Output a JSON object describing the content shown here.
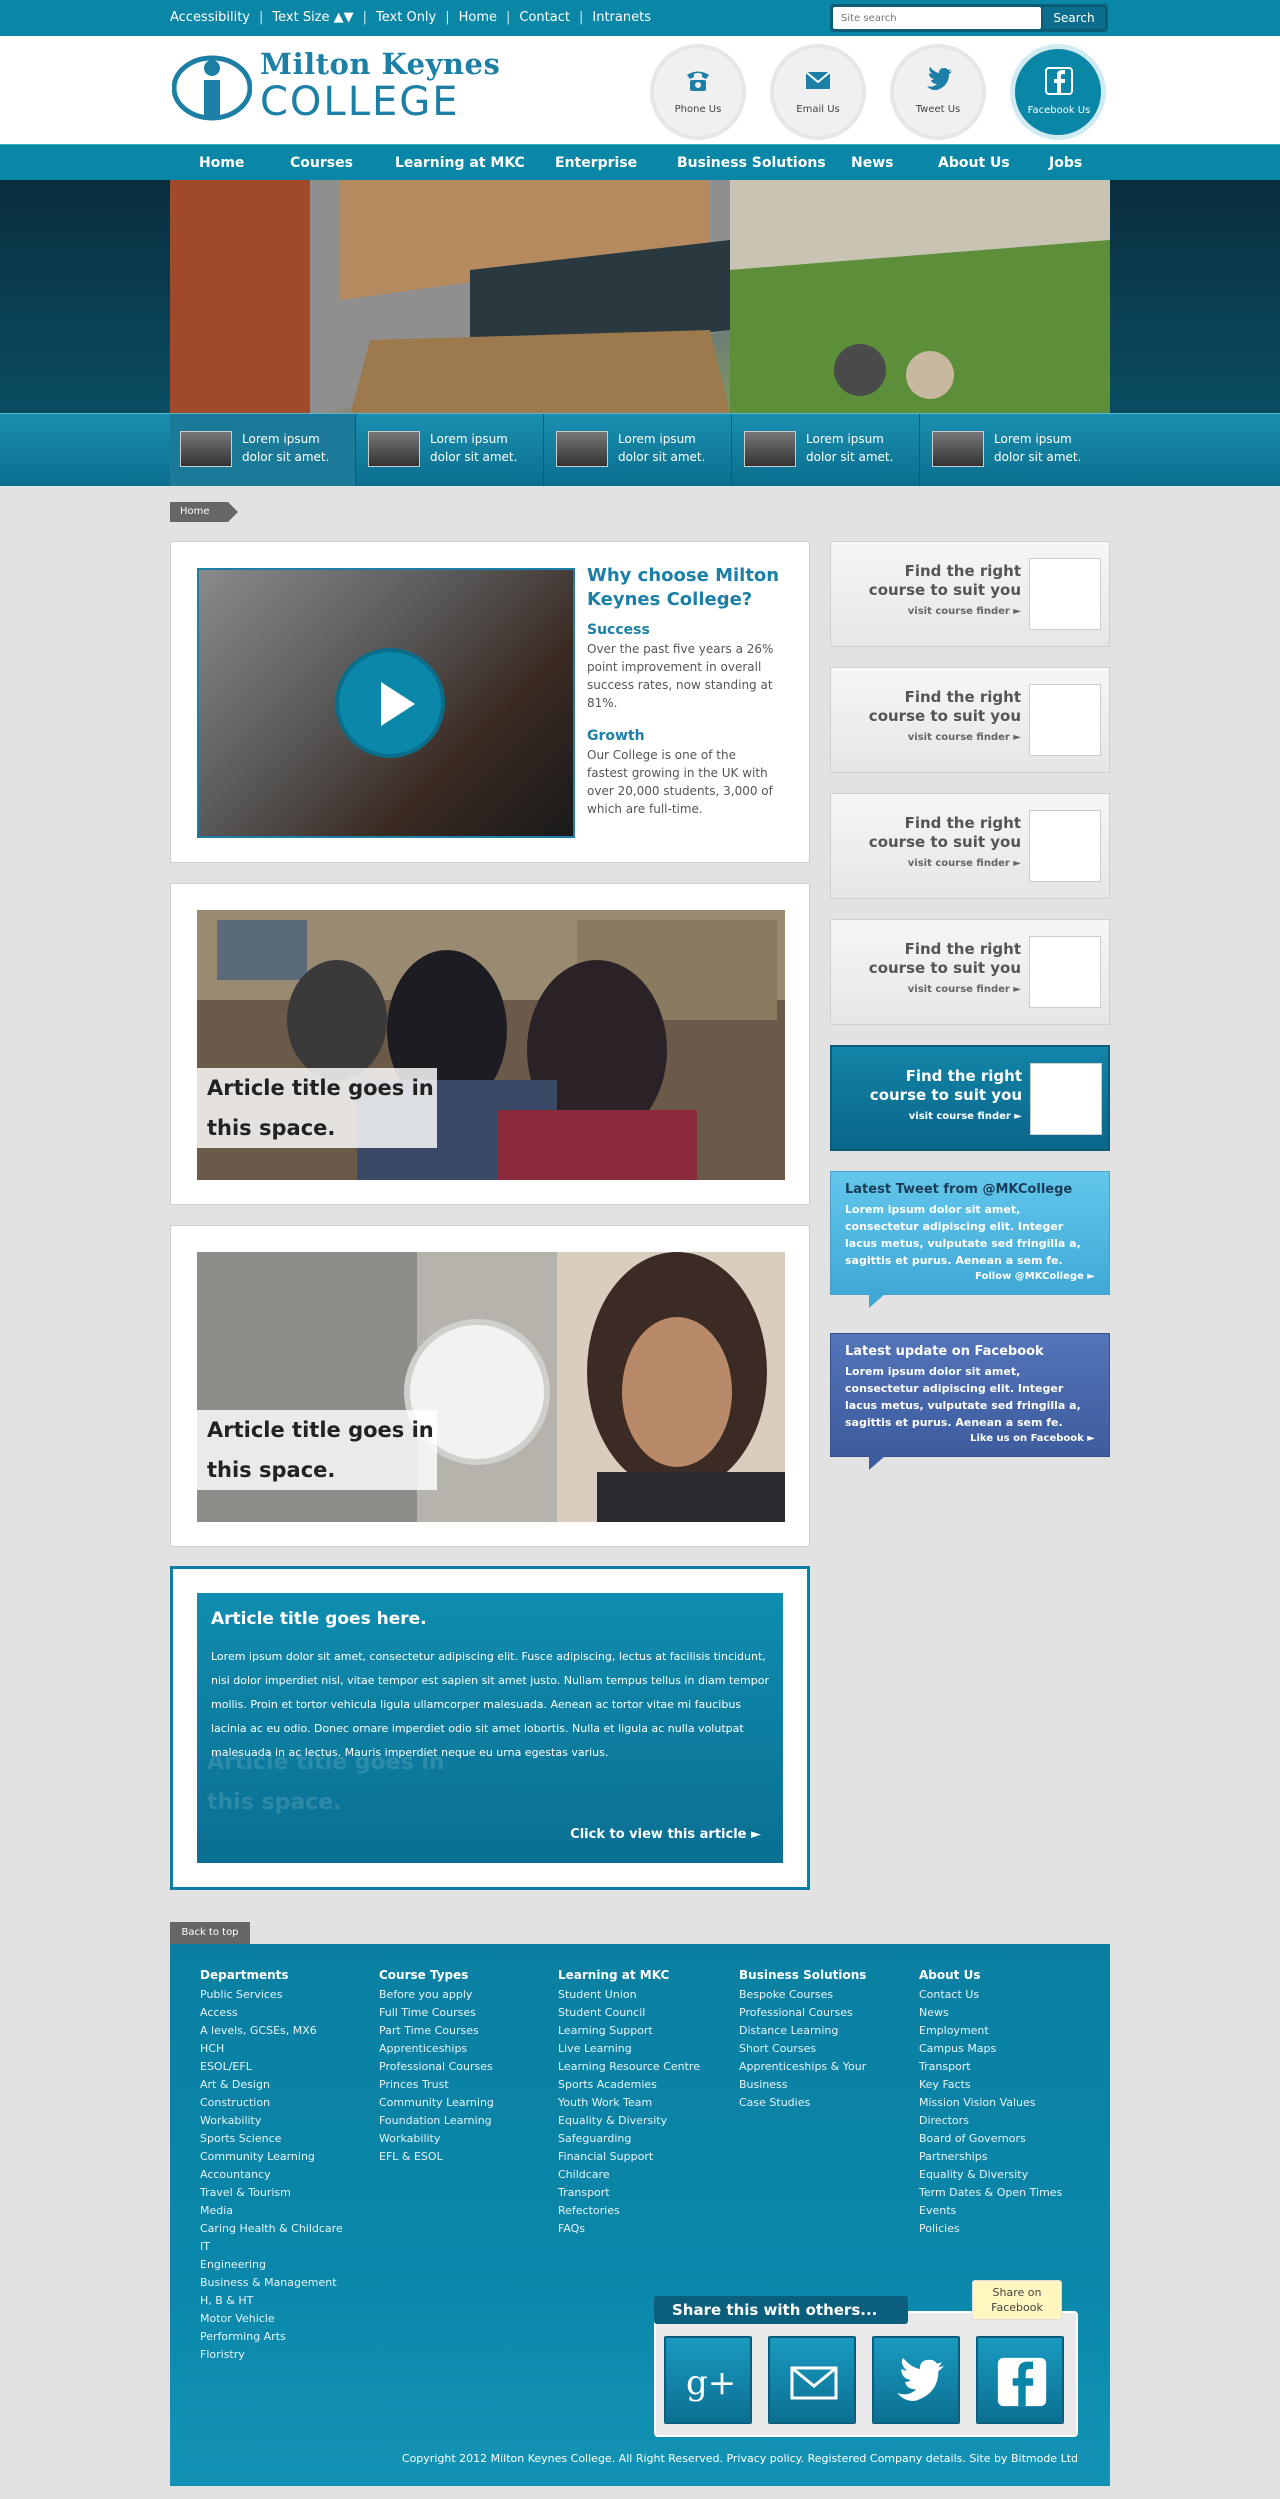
{
  "util": {
    "accessibility": "Accessibility",
    "text_size": "Text Size ▲▼",
    "text_only": "Text Only",
    "home": "Home",
    "contact": "Contact",
    "intranets": "Intranets",
    "search_placeholder": "Site search",
    "search_button": "Search"
  },
  "logo": {
    "line1": "Milton Keynes",
    "line2": "COLLEGE"
  },
  "contact_circles": {
    "phone": "Phone Us",
    "email": "Email Us",
    "tweet": "Tweet Us",
    "facebook": "Facebook Us"
  },
  "nav": {
    "home": "Home",
    "courses": "Courses",
    "learning": "Learning at MKC",
    "enterprise": "Enterprise",
    "business": "Business Solutions",
    "news": "News",
    "about": "About Us",
    "jobs": "Jobs"
  },
  "slides": [
    "Lorem ipsum dolor sit amet.",
    "Lorem ipsum dolor sit amet.",
    "Lorem ipsum dolor sit amet.",
    "Lorem ipsum dolor sit amet.",
    "Lorem ipsum dolor sit amet."
  ],
  "breadcrumb": "Home",
  "why": {
    "title": "Why choose Milton Keynes College?",
    "success_h": "Success",
    "success_t": "Over the past five years a 26% point improvement in overall success rates, now standing at 81%.",
    "growth_h": "Growth",
    "growth_t": "Our College is one of the fastest growing in the UK with over 20,000 students, 3,000 of which are full-time."
  },
  "articles": [
    {
      "title": "Article title goes in this space."
    },
    {
      "title": "Article title goes in this space."
    }
  ],
  "feature": {
    "title": "Article title goes here.",
    "body": "Lorem ipsum dolor sit amet, consectetur adipiscing elit. Fusce adipiscing, lectus at facilisis tincidunt, nisi dolor imperdiet nisl, vitae tempor est sapien sit amet justo. Nullam tempus tellus in diam tempor mollis. Proin et tortor vehicula ligula ullamcorper malesuada. Aenean ac tortor vitae mi faucibus lacinia ac eu odio. Donec ornare imperdiet odio sit amet lobortis. Nulla et ligula ac nulla volutpat malesuada in ac lectus. Mauris imperdiet neque eu urna egestas varius.",
    "link": "Click to view this article ►",
    "ghost": "Article title goes in this space."
  },
  "finder": [
    {
      "title": "Find the right course to suit you",
      "link": "visit course finder ►"
    },
    {
      "title": "Find the right course to suit you",
      "link": "visit course finder ►"
    },
    {
      "title": "Find the right course to suit you",
      "link": "visit course finder ►"
    },
    {
      "title": "Find the right course to suit you",
      "link": "visit course finder ►"
    },
    {
      "title": "Find the right course to suit you",
      "link": "visit course finder ►"
    }
  ],
  "tweet": {
    "title": "Latest Tweet from @MKCollege",
    "text": "Lorem ipsum dolor sit amet, consectetur adipiscing elit. Integer lacus metus, vulputate sed fringilla a, sagittis et purus. Aenean a sem fe.",
    "link": "Follow @MKCollege ►"
  },
  "facebook": {
    "title": "Latest update on Facebook",
    "text": "Lorem ipsum dolor sit amet, consectetur adipiscing elit. Integer lacus metus, vulputate sed fringilla a, sagittis et purus. Aenean a sem fe.",
    "link": "Like us on Facebook ►"
  },
  "back_to_top": "Back to top",
  "footer": {
    "departments": {
      "heading": "Departments",
      "items": [
        "Public Services",
        "Access",
        "A levels, GCSEs, MX6",
        "HCH",
        "ESOL/EFL",
        "Art & Design",
        "Construction",
        "Workability",
        "Sports Science",
        "Community Learning",
        "Accountancy",
        "Travel & Tourism",
        "Media",
        "Caring Health & Childcare",
        "IT",
        "Engineering",
        "Business & Management",
        "H, B & HT",
        "Motor Vehicle",
        "Performing Arts",
        "Floristry"
      ]
    },
    "course_types": {
      "heading": "Course Types",
      "items": [
        "Before you apply",
        "Full Time Courses",
        "Part Time Courses",
        "Apprenticeships",
        "Professional Courses",
        "Princes Trust",
        "Community Learning",
        "Foundation Learning",
        "Workability",
        "EFL & ESOL"
      ]
    },
    "learning": {
      "heading": "Learning at MKC",
      "items": [
        "Student Union",
        "Student Council",
        "Learning Support",
        "Live Learning",
        "Learning Resource Centre",
        "Sports Academies",
        "Youth Work Team",
        "Equality & Diversity",
        "Safeguarding",
        "Financial Support",
        "Childcare",
        "Transport",
        "Refectories",
        "FAQs"
      ]
    },
    "business": {
      "heading": "Business Solutions",
      "items": [
        "Bespoke Courses",
        "Professional Courses",
        "Distance Learning",
        "Short Courses",
        "Apprenticeships & Your",
        "Business",
        "Case Studies"
      ]
    },
    "about": {
      "heading": "About Us",
      "items": [
        "Contact Us",
        "News",
        "Employment",
        "Campus Maps",
        "Transport",
        "Key Facts",
        "Mission Vision Values",
        "Directors",
        "Board of Governors",
        "Partnerships",
        "Equality & Diversity",
        "Term Dates & Open Times",
        "Events",
        "Policies"
      ]
    },
    "share_label": "Share this with others...",
    "share_tip": "Share on Facebook",
    "copyright": "Copyright 2012 Milton Keynes College. All Right Reserved. Privacy policy. Registered Company details. Site by Bitmode Ltd"
  }
}
